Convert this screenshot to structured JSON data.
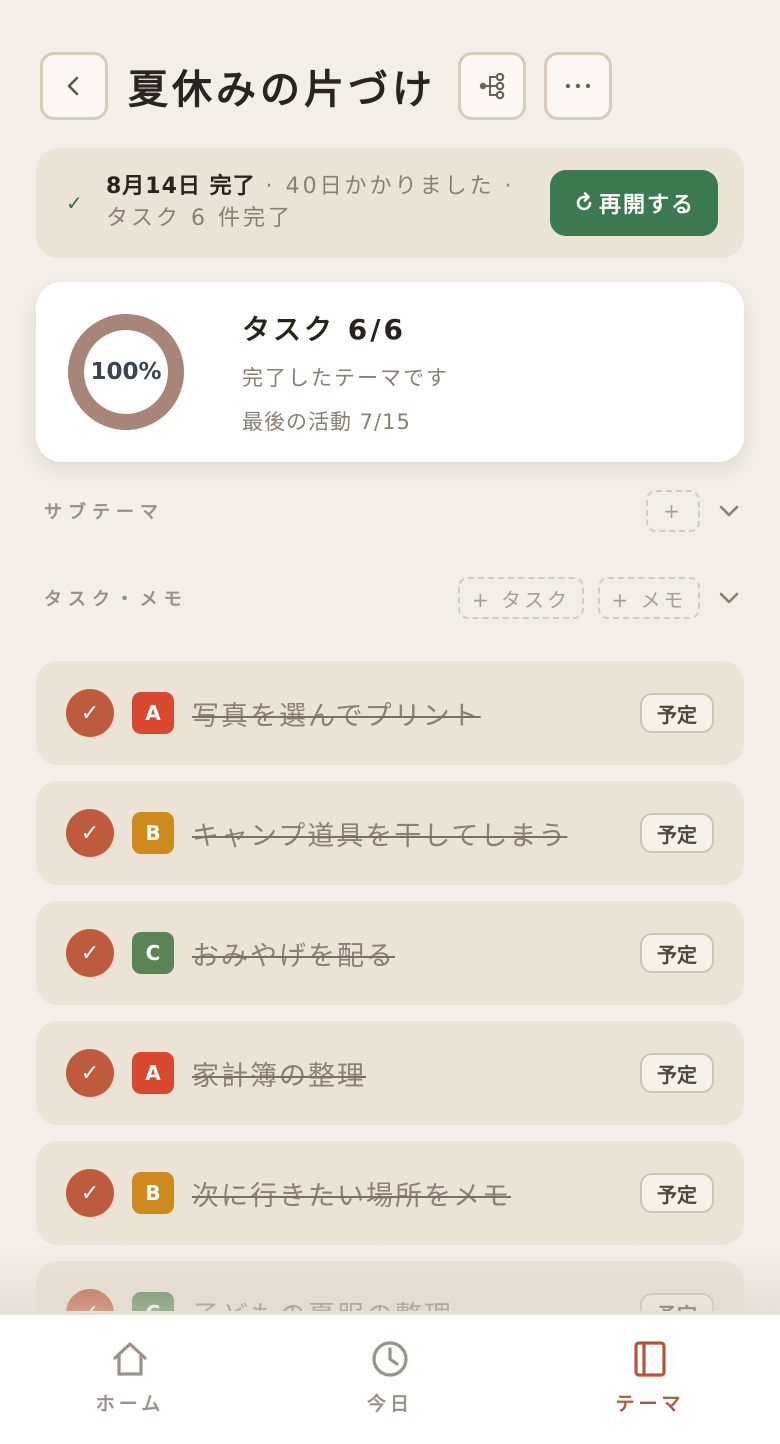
{
  "header": {
    "title": "夏休みの片づけ",
    "back_icon": "chevron-left-icon",
    "tree_icon": "tree-icon",
    "more_icon": "more-icon"
  },
  "banner": {
    "date_status": "8月14日 完了",
    "detail": " · 40日かかりました · タスク 6 件完了",
    "reopen_label": "再開する"
  },
  "summary": {
    "percent": "100%",
    "task_count_label": "タスク 6/6",
    "subtitle": "完了したテーマです",
    "last_activity": "最後の活動 7/15",
    "progress": 1.0
  },
  "sections": {
    "subtheme_label": "サブテーマ",
    "subtheme_add": "+",
    "tasks_label": "タスク・メモ",
    "add_task": "+ タスク",
    "add_memo": "+ メモ"
  },
  "tasks": [
    {
      "priority": "A",
      "name": "写真を選んでプリント",
      "tag": "予定"
    },
    {
      "priority": "B",
      "name": "キャンプ道具を干してしまう",
      "tag": "予定"
    },
    {
      "priority": "C",
      "name": "おみやげを配る",
      "tag": "予定"
    },
    {
      "priority": "A",
      "name": "家計簿の整理",
      "tag": "予定"
    },
    {
      "priority": "B",
      "name": "次に行きたい場所をメモ",
      "tag": "予定"
    },
    {
      "priority": "C",
      "name": "子どもの夏服の整理",
      "tag": "予定"
    }
  ],
  "colors": {
    "A": "#d9482f",
    "B": "#cf8a1e",
    "C": "#5a8456"
  },
  "nav": [
    {
      "label": "ホーム",
      "icon": "home-icon"
    },
    {
      "label": "今日",
      "icon": "clock-icon"
    },
    {
      "label": "テーマ",
      "icon": "book-icon"
    }
  ]
}
